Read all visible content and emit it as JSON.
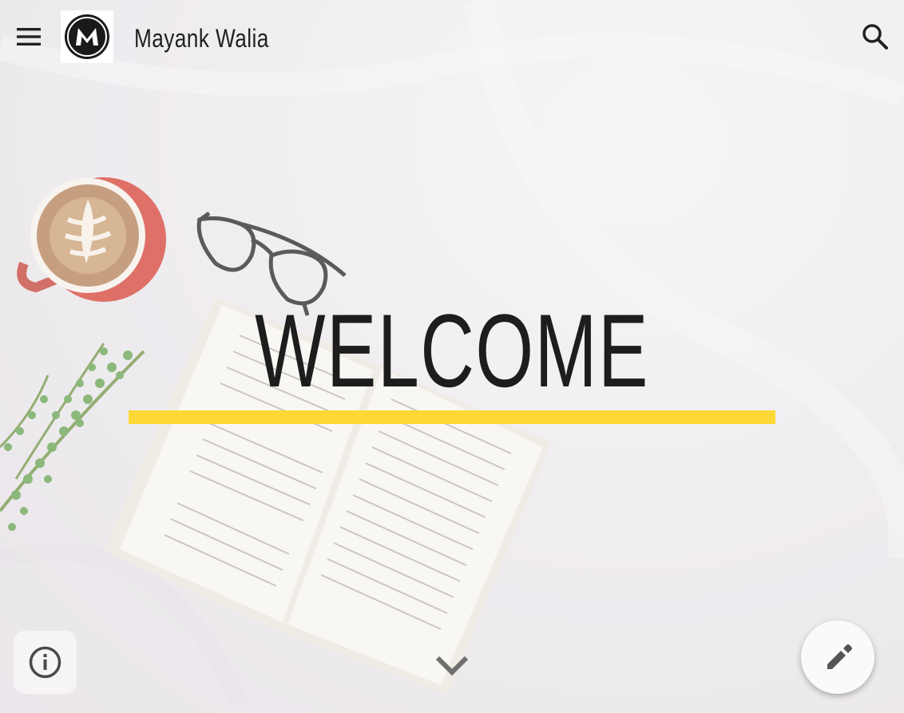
{
  "header": {
    "site_title": "Mayank Walia",
    "logo_letter": "M",
    "menu_icon": "menu-icon",
    "search_icon": "search-icon"
  },
  "hero": {
    "heading": "WELCOME",
    "accent_color": "#fdd835",
    "scroll_icon": "chevron-down-icon"
  },
  "footer_controls": {
    "info_icon": "info-icon",
    "edit_icon": "pencil-icon"
  }
}
